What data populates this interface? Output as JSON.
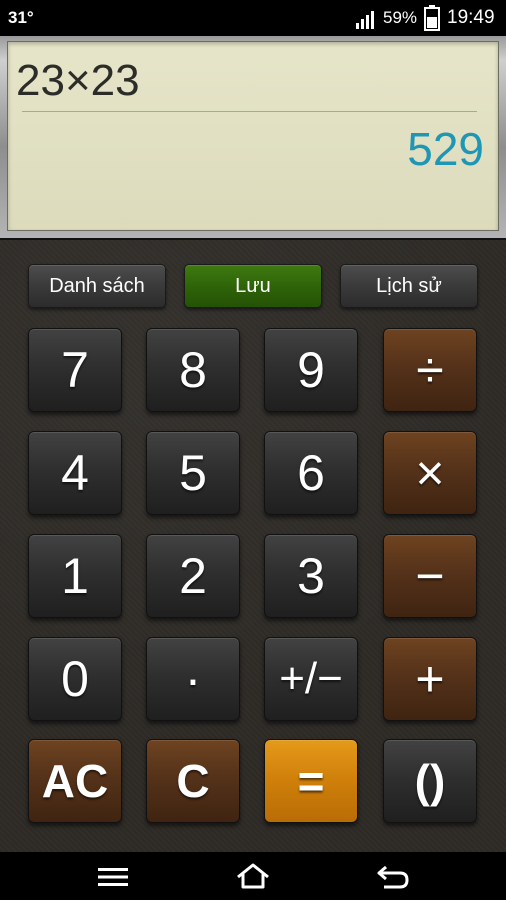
{
  "status_bar": {
    "temperature": "31°",
    "battery_percent": "59%",
    "time": "19:49",
    "icons": [
      "signal-icon",
      "battery-icon"
    ]
  },
  "display": {
    "expression": "23×23",
    "result": "529"
  },
  "function_buttons": {
    "list": "Danh sách",
    "save": "Lưu",
    "history": "Lịch sử"
  },
  "keys": {
    "seven": "7",
    "eight": "8",
    "nine": "9",
    "divide": "÷",
    "four": "4",
    "five": "5",
    "six": "6",
    "multiply": "×",
    "one": "1",
    "two": "2",
    "three": "3",
    "minus": "−",
    "zero": "0",
    "dot": "·",
    "plus_minus": "+/−",
    "plus": "+",
    "ac": "AC",
    "clear": "C",
    "equals": "=",
    "parentheses": "()"
  },
  "nav_bar": {
    "icons": [
      "menu-icon",
      "home-icon",
      "back-icon"
    ]
  },
  "colors": {
    "result_text": "#1e96b5",
    "save_button": "#2f6409",
    "operator_key": "#55321a",
    "equals_key": "#cf7f0a",
    "digit_key": "#2f2f2f"
  }
}
